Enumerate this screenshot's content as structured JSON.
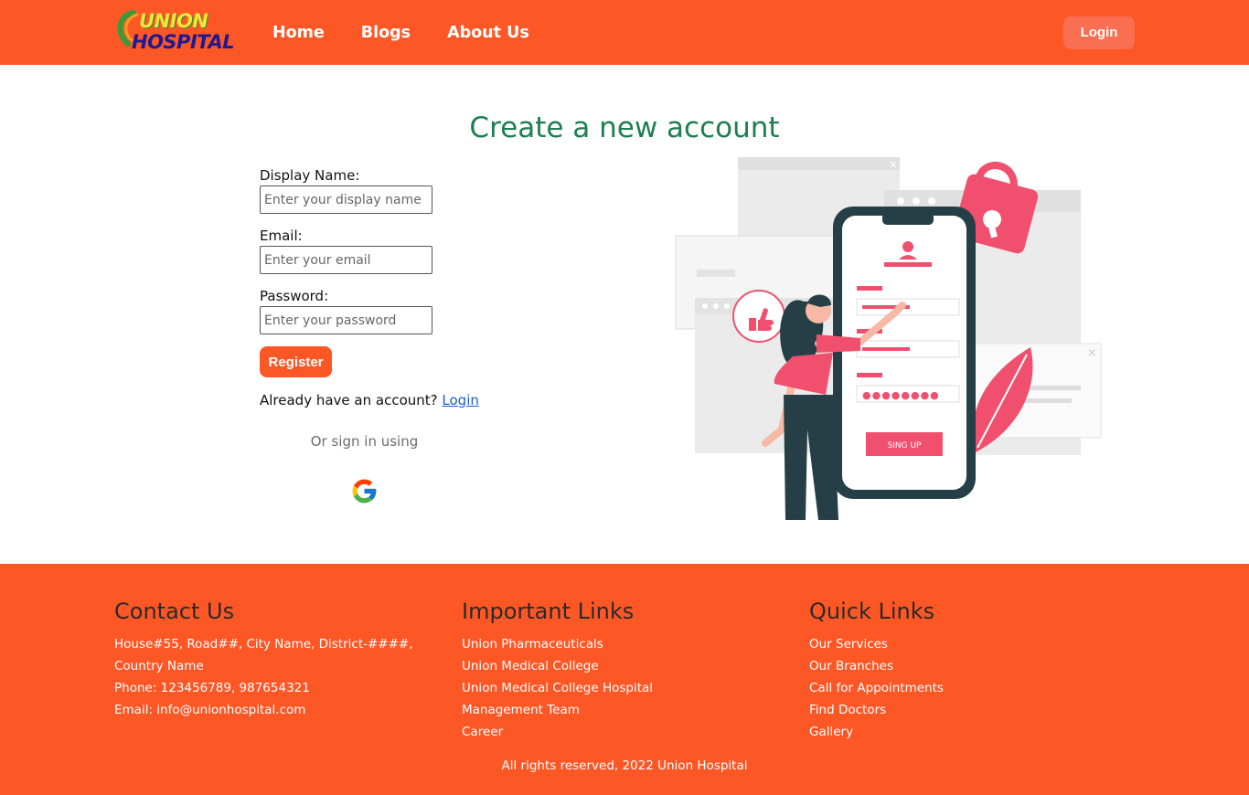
{
  "brand": {
    "line1": "UNION",
    "line2": "HOSPITAL"
  },
  "nav": {
    "links": [
      "Home",
      "Blogs",
      "About Us"
    ],
    "login_label": "Login"
  },
  "form": {
    "title": "Create a new account",
    "display_name_label": "Display Name:",
    "display_name_placeholder": "Enter your display name",
    "email_label": "Email:",
    "email_placeholder": "Enter your email",
    "password_label": "Password:",
    "password_placeholder": "Enter your password",
    "register_label": "Register",
    "have_account_text": "Already have an account?",
    "login_link": "Login",
    "or_signin": "Or sign in using",
    "google_icon": "google-icon"
  },
  "illustration": {
    "button_text": "SING UP"
  },
  "footer": {
    "contact": {
      "title": "Contact Us",
      "address": "House#55, Road##, City Name, District-####, Country Name",
      "phone": "Phone: 123456789, 987654321",
      "email": "Email: info@unionhospital.com"
    },
    "important": {
      "title": "Important Links",
      "links": [
        "Union Pharmaceuticals",
        "Union Medical College",
        "Union Medical College Hospital",
        "Management Team",
        "Career"
      ]
    },
    "quick": {
      "title": "Quick Links",
      "links": [
        "Our Services",
        "Our Branches",
        "Call for Appointments",
        "Find Doctors",
        "Gallery"
      ]
    },
    "copyright": "All rights reserved, 2022 Union Hospital"
  },
  "colors": {
    "brand_orange": "#fd5726",
    "title_green": "#1c7f52",
    "link_blue": "#1a5fd9",
    "illustration_red": "#f0506e"
  }
}
